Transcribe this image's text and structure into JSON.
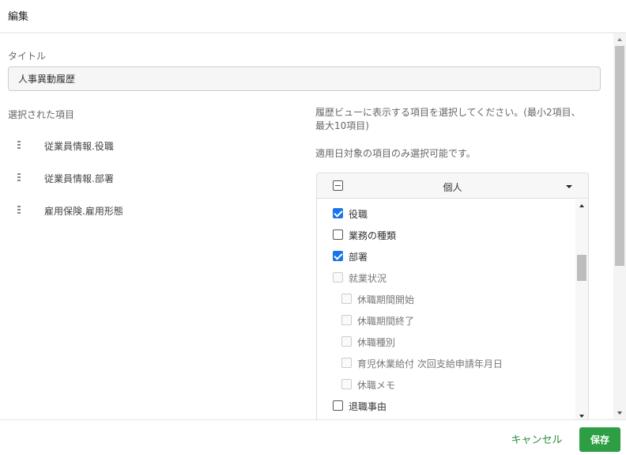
{
  "header": {
    "title": "編集"
  },
  "form": {
    "title_label": "タイトル",
    "title_value": "人事異動履歴",
    "selected_label": "選択された項目",
    "selected_items": [
      {
        "label": "従業員情報.役職",
        "icon": "drag-handle-icon"
      },
      {
        "label": "従業員情報.部署",
        "icon": "drag-handle-icon"
      },
      {
        "label": "雇用保険.雇用形態",
        "icon": "drag-handle-icon"
      }
    ],
    "hint_line1": "履歴ビューに表示する項目を選択してください。(最小2項目、最大10項目)",
    "hint_line2": "適用日対象の項目のみ選択可能です。"
  },
  "picker": {
    "group_label": "個人",
    "options": [
      {
        "label": "役職",
        "checked": true,
        "disabled": false,
        "indent": 0
      },
      {
        "label": "業務の種類",
        "checked": false,
        "disabled": false,
        "indent": 0
      },
      {
        "label": "部署",
        "checked": true,
        "disabled": false,
        "indent": 0
      },
      {
        "label": "就業状況",
        "checked": false,
        "disabled": true,
        "indent": 0
      },
      {
        "label": "休職期間開始",
        "checked": false,
        "disabled": true,
        "indent": 1
      },
      {
        "label": "休職期間終了",
        "checked": false,
        "disabled": true,
        "indent": 1
      },
      {
        "label": "休職種別",
        "checked": false,
        "disabled": true,
        "indent": 1
      },
      {
        "label": "育児休業給付 次回支給申請年月日",
        "checked": false,
        "disabled": true,
        "indent": 1
      },
      {
        "label": "休職メモ",
        "checked": false,
        "disabled": true,
        "indent": 1
      },
      {
        "label": "退職事由",
        "checked": false,
        "disabled": false,
        "indent": 0
      }
    ]
  },
  "footer": {
    "cancel_label": "キャンセル",
    "save_label": "保存"
  },
  "colors": {
    "accent_green": "#2e9e45",
    "checkbox_blue": "#1a73e8"
  }
}
